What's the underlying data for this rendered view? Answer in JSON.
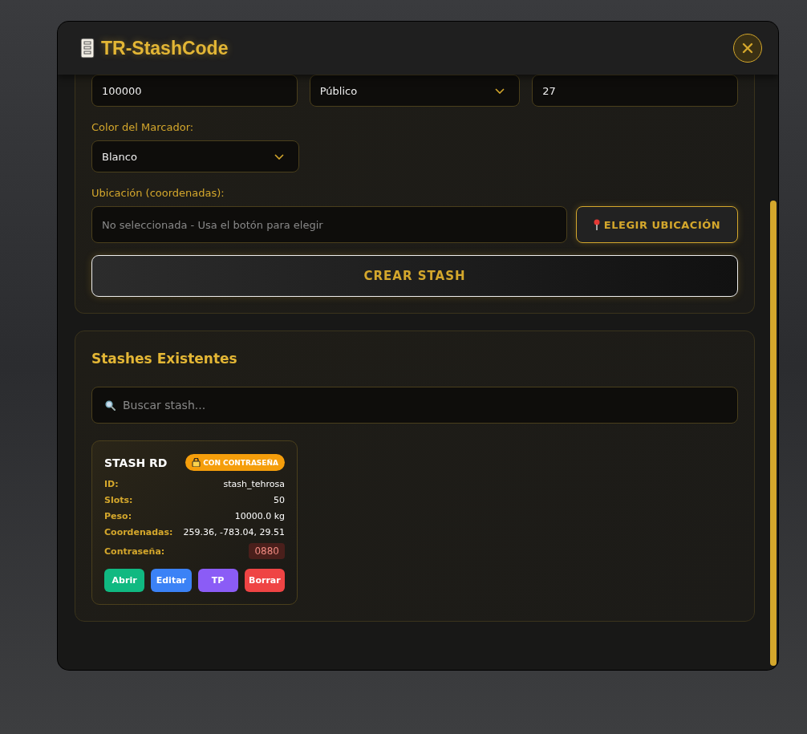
{
  "window": {
    "title": "TR-StashCode"
  },
  "form": {
    "top_fields": [
      {
        "kind": "input",
        "value": "100000"
      },
      {
        "kind": "select",
        "value": "Público"
      },
      {
        "kind": "input",
        "value": "27"
      }
    ],
    "marker_color": {
      "label": "Color del Marcador:",
      "value": "Blanco"
    },
    "location": {
      "label": "Ubicación (coordenadas):",
      "placeholder": "No seleccionada - Usa el botón para elegir",
      "pick_button": "ELEGIR UBICACIÓN"
    },
    "create_button": "CREAR STASH"
  },
  "stashes": {
    "title": "Stashes Existentes",
    "search": {
      "placeholder": "Buscar stash..."
    },
    "cards": [
      {
        "name": "STASH RD",
        "badge": "CON CONTRASEÑA",
        "fields": [
          {
            "label": "ID:",
            "value": "stash_tehrosa",
            "kind": "text"
          },
          {
            "label": "Slots:",
            "value": "50",
            "kind": "text"
          },
          {
            "label": "Peso:",
            "value": "10000.0 kg",
            "kind": "text"
          },
          {
            "label": "Coordenadas:",
            "value": "259.36, -783.04, 29.51",
            "kind": "text"
          },
          {
            "label": "Contraseña:",
            "value": "0880",
            "kind": "secret"
          }
        ],
        "actions": [
          {
            "label": "Abrir",
            "color": "#10b981"
          },
          {
            "label": "Editar",
            "color": "#3b82f6"
          },
          {
            "label": "TP",
            "color": "#8b5cf6"
          },
          {
            "label": "Borrar",
            "color": "#ef4444"
          }
        ]
      }
    ]
  }
}
